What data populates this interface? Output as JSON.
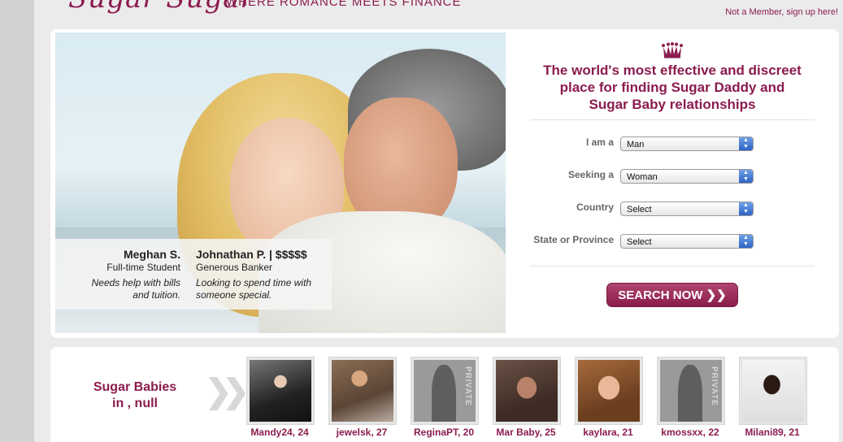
{
  "header": {
    "logo_text": "Sugar Sugar",
    "tagline": "WHERE ROMANCE MEETS FINANCE",
    "signup_link": "Not a Member, sign up here!"
  },
  "hero": {
    "caption_left": {
      "name": "Meghan S.",
      "role": "Full-time Student",
      "line1": "Needs help with bills",
      "line2": "and tuition."
    },
    "caption_right": {
      "name": "Johnathan P. | $$$$$",
      "role": "Generous Banker",
      "line1": "Looking to spend time with",
      "line2": "someone special."
    }
  },
  "search": {
    "headline_1": "The world's most effective and discreet",
    "headline_2": "place for finding Sugar Daddy and",
    "headline_3": "Sugar Baby relationships",
    "fields": [
      {
        "label": "I am a",
        "value": "Man"
      },
      {
        "label": "Seeking a",
        "value": "Woman"
      },
      {
        "label": "Country",
        "value": "Select"
      },
      {
        "label": "State or Province",
        "value": "Select"
      }
    ],
    "button_label": "SEARCH NOW ❯❯"
  },
  "babies": {
    "title_1": "Sugar Babies",
    "title_2": "in , null",
    "private_label": "PRIVATE",
    "profiles": [
      {
        "name": "Mandy24, 24"
      },
      {
        "name": "jewelsk, 27"
      },
      {
        "name": "ReginaPT, 20"
      },
      {
        "name": "Mar Baby, 25"
      },
      {
        "name": "kaylara, 21"
      },
      {
        "name": "kmossxx, 22"
      },
      {
        "name": "Milani89, 21"
      }
    ]
  },
  "colors": {
    "brand": "#8b1c4e",
    "button": "#a0335f",
    "select_arrow": "#3a70d0"
  }
}
